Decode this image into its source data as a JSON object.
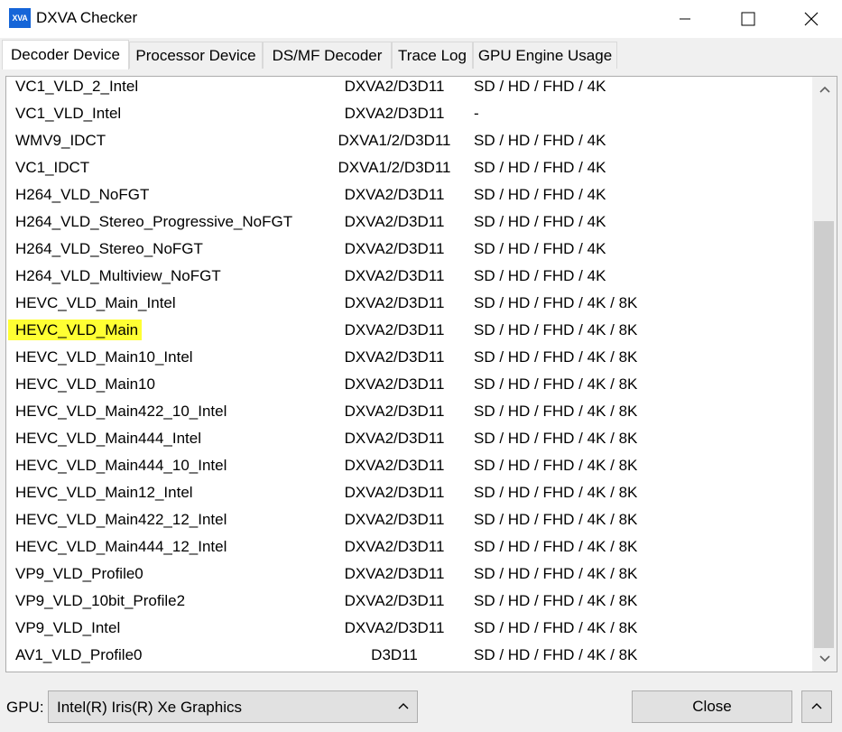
{
  "window": {
    "title": "DXVA Checker",
    "icon_text": "XVA"
  },
  "tabs": [
    {
      "label": "Decoder Device",
      "active": true
    },
    {
      "label": "Processor Device",
      "active": false
    },
    {
      "label": "DS/MF Decoder",
      "active": false
    },
    {
      "label": "Trace Log",
      "active": false
    },
    {
      "label": "GPU Engine Usage",
      "active": false
    }
  ],
  "decoders": [
    {
      "name": "VC1_VLD_2_Intel",
      "api": "DXVA2/D3D11",
      "res": "SD / HD / FHD / 4K"
    },
    {
      "name": "VC1_VLD_Intel",
      "api": "DXVA2/D3D11",
      "res": "-"
    },
    {
      "name": "WMV9_IDCT",
      "api": "DXVA1/2/D3D11",
      "res": "SD / HD / FHD / 4K"
    },
    {
      "name": "VC1_IDCT",
      "api": "DXVA1/2/D3D11",
      "res": "SD / HD / FHD / 4K"
    },
    {
      "name": "H264_VLD_NoFGT",
      "api": "DXVA2/D3D11",
      "res": "SD / HD / FHD / 4K"
    },
    {
      "name": "H264_VLD_Stereo_Progressive_NoFGT",
      "api": "DXVA2/D3D11",
      "res": "SD / HD / FHD / 4K"
    },
    {
      "name": "H264_VLD_Stereo_NoFGT",
      "api": "DXVA2/D3D11",
      "res": "SD / HD / FHD / 4K"
    },
    {
      "name": "H264_VLD_Multiview_NoFGT",
      "api": "DXVA2/D3D11",
      "res": "SD / HD / FHD / 4K"
    },
    {
      "name": "HEVC_VLD_Main_Intel",
      "api": "DXVA2/D3D11",
      "res": "SD / HD / FHD / 4K / 8K"
    },
    {
      "name": "HEVC_VLD_Main",
      "api": "DXVA2/D3D11",
      "res": "SD / HD / FHD / 4K / 8K",
      "highlighted": true
    },
    {
      "name": "HEVC_VLD_Main10_Intel",
      "api": "DXVA2/D3D11",
      "res": "SD / HD / FHD / 4K / 8K"
    },
    {
      "name": "HEVC_VLD_Main10",
      "api": "DXVA2/D3D11",
      "res": "SD / HD / FHD / 4K / 8K"
    },
    {
      "name": "HEVC_VLD_Main422_10_Intel",
      "api": "DXVA2/D3D11",
      "res": "SD / HD / FHD / 4K / 8K"
    },
    {
      "name": "HEVC_VLD_Main444_Intel",
      "api": "DXVA2/D3D11",
      "res": "SD / HD / FHD / 4K / 8K"
    },
    {
      "name": "HEVC_VLD_Main444_10_Intel",
      "api": "DXVA2/D3D11",
      "res": "SD / HD / FHD / 4K / 8K"
    },
    {
      "name": "HEVC_VLD_Main12_Intel",
      "api": "DXVA2/D3D11",
      "res": "SD / HD / FHD / 4K / 8K"
    },
    {
      "name": "HEVC_VLD_Main422_12_Intel",
      "api": "DXVA2/D3D11",
      "res": "SD / HD / FHD / 4K / 8K"
    },
    {
      "name": "HEVC_VLD_Main444_12_Intel",
      "api": "DXVA2/D3D11",
      "res": "SD / HD / FHD / 4K / 8K"
    },
    {
      "name": "VP9_VLD_Profile0",
      "api": "DXVA2/D3D11",
      "res": "SD / HD / FHD / 4K / 8K"
    },
    {
      "name": "VP9_VLD_10bit_Profile2",
      "api": "DXVA2/D3D11",
      "res": "SD / HD / FHD / 4K / 8K"
    },
    {
      "name": "VP9_VLD_Intel",
      "api": "DXVA2/D3D11",
      "res": "SD / HD / FHD / 4K / 8K"
    },
    {
      "name": "AV1_VLD_Profile0",
      "api": "D3D11",
      "res": "SD / HD / FHD / 4K / 8K"
    }
  ],
  "footer": {
    "gpu_label": "GPU:",
    "gpu_value": "Intel(R) Iris(R) Xe Graphics",
    "close_label": "Close"
  },
  "colors": {
    "highlight": "#ffff33",
    "app_icon": "#1565d8"
  }
}
